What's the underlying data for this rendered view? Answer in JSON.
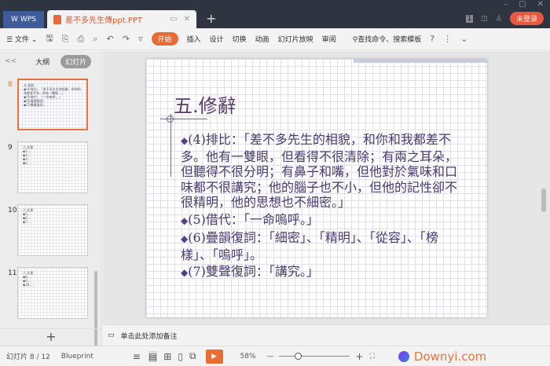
{
  "titlebar": {
    "wps_label": "WPS",
    "doc_tab": "差不多先生傳ppt.PPT",
    "new_tab": "+",
    "login": "未登录",
    "badge": "1"
  },
  "toolbar": {
    "menu": "文件",
    "tabs": [
      "开始",
      "插入",
      "设计",
      "切换",
      "动画",
      "幻灯片放映",
      "审阅"
    ],
    "search": "查找命令、搜索模板"
  },
  "left_panel": {
    "outline": "大纲",
    "slides": "幻灯片",
    "collapse": "<<",
    "add": "+",
    "thumbs": [
      {
        "num": "8",
        "title": "五.修辭"
      },
      {
        "num": "9",
        "title": "六.文意"
      },
      {
        "num": "10",
        "title": "六.文意"
      },
      {
        "num": "11",
        "title": "六.文意"
      }
    ]
  },
  "slide": {
    "title": "五.修辭",
    "bullets": [
      "(4)排比：「差不多先生的相貌，和你和我都差不多。他有一雙眼，但看得不很清除；有兩之耳朵，但聽得不很分明；有鼻子和嘴，但他對於氣味和口味都不很講究；他的腦子也不小，但他的記性卻不很精明，他的思想也不細密。」",
      "(5)借代：「一命嗚呼。」",
      "(6)疊韻復詞：「細密」、「精明」、「從容」、「榜樣」、「嗚呼」。",
      "(7)雙聲復詞：「講究。」"
    ]
  },
  "notes": {
    "placeholder": "单击此处添加备注"
  },
  "status": {
    "slide_count": "幻灯片 8 / 12",
    "theme": "Blueprint",
    "zoom": "58%",
    "zoom_level": 0.58,
    "watermark": "Downyi.com"
  }
}
